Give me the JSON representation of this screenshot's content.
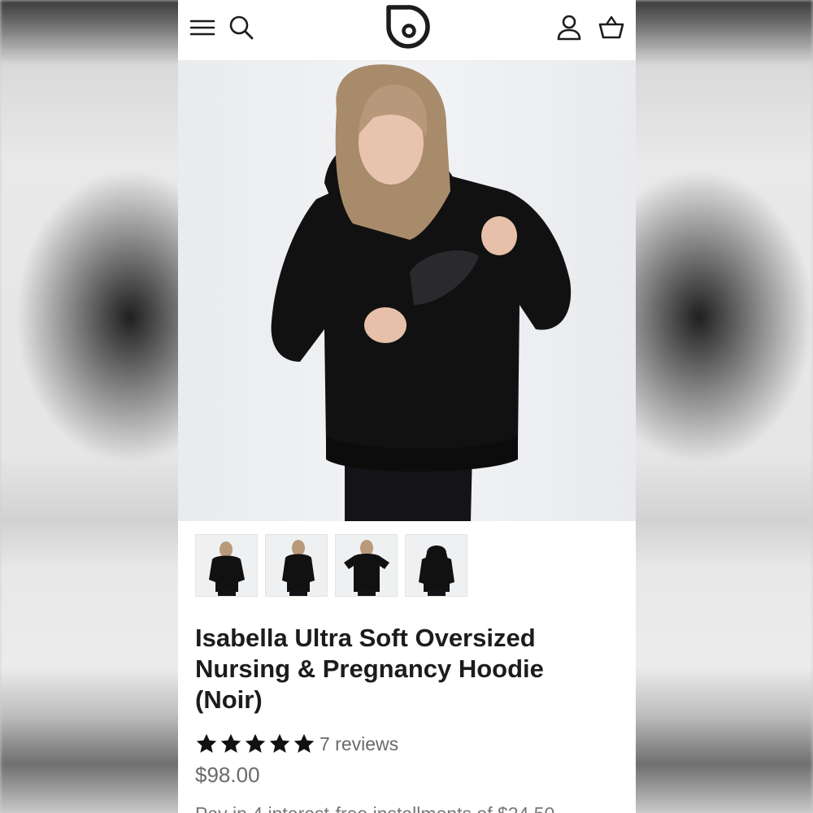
{
  "header": {
    "icons": [
      "menu-icon",
      "search-icon",
      "brand-logo-icon",
      "account-icon",
      "cart-icon"
    ]
  },
  "product": {
    "title": "Isabella Ultra Soft Oversized Nursing & Pregnancy Hoodie (Noir)",
    "rating": {
      "stars": 5,
      "reviews_label": "7 reviews"
    },
    "price": "$98.00",
    "installments_text": "Pay in 4 interest-free installments of $24.50",
    "thumbnails": [
      "thumbnail-1",
      "thumbnail-2",
      "thumbnail-3",
      "thumbnail-4"
    ]
  },
  "colors": {
    "text": "#1c1c1c",
    "muted": "#6a6a6a",
    "hoodie": "#111111",
    "background": "#ffffff"
  }
}
